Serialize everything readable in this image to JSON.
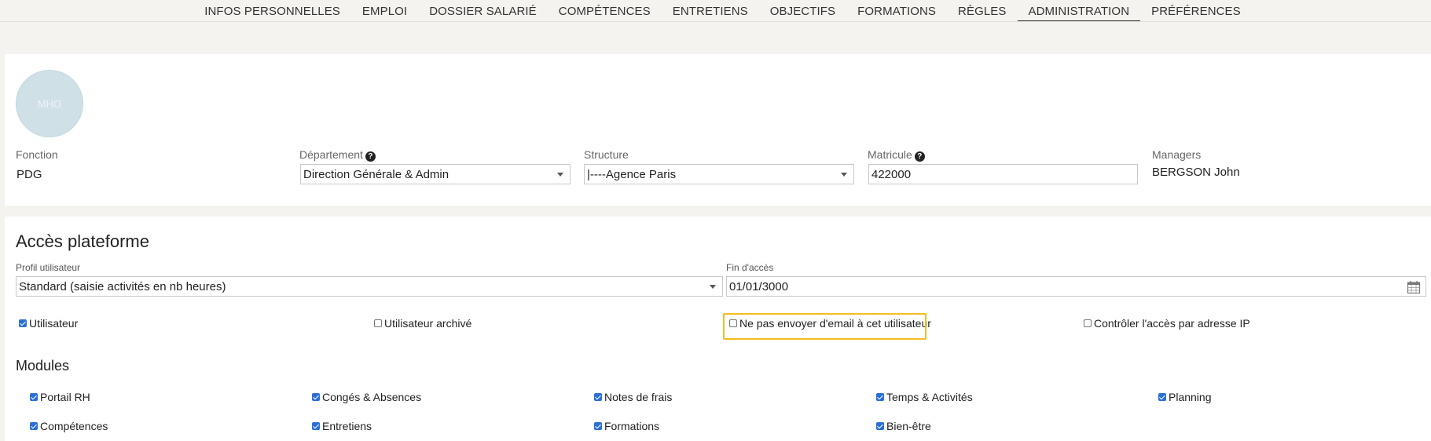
{
  "nav": {
    "tabs": [
      "INFOS PERSONNELLES",
      "EMPLOI",
      "DOSSIER SALARIÉ",
      "COMPÉTENCES",
      "ENTRETIENS",
      "OBJECTIFS",
      "FORMATIONS",
      "RÈGLES",
      "ADMINISTRATION",
      "PRÉFÉRENCES"
    ],
    "active": "ADMINISTRATION"
  },
  "profile": {
    "avatar_initials": "MHO",
    "fonction_label": "Fonction",
    "fonction_value": "PDG",
    "departement_label": "Département",
    "departement_value": "Direction Générale & Admin",
    "structure_label": "Structure",
    "structure_value": "|----Agence Paris",
    "matricule_label": "Matricule",
    "matricule_value": "422000",
    "managers_label": "Managers",
    "managers_value": "BERGSON John"
  },
  "acces": {
    "title": "Accès plateforme",
    "profil_label": "Profil utilisateur",
    "profil_value": "Standard (saisie activités en nb heures)",
    "fin_label": "Fin d'accès",
    "fin_value": "01/01/3000",
    "options": [
      {
        "label": "Utilisateur",
        "checked": true
      },
      {
        "label": "Utilisateur archivé",
        "checked": false
      },
      {
        "label": "Ne pas envoyer d'email à cet utilisateur",
        "checked": false
      },
      {
        "label": "Contrôler l'accès par adresse IP",
        "checked": false
      }
    ]
  },
  "modules": {
    "title": "Modules",
    "items": [
      {
        "label": "Portail RH",
        "checked": true
      },
      {
        "label": "Congés & Absences",
        "checked": true
      },
      {
        "label": "Notes de frais",
        "checked": true
      },
      {
        "label": "Temps & Activités",
        "checked": true
      },
      {
        "label": "Planning",
        "checked": true
      },
      {
        "label": "Compétences",
        "checked": true
      },
      {
        "label": "Entretiens",
        "checked": true
      },
      {
        "label": "Formations",
        "checked": true
      },
      {
        "label": "Bien-être",
        "checked": true
      }
    ]
  },
  "colors": {
    "accent_checkbox": "#2b6fd6",
    "highlight": "#f5bd1f",
    "avatar_bg": "#cfe0e6"
  }
}
